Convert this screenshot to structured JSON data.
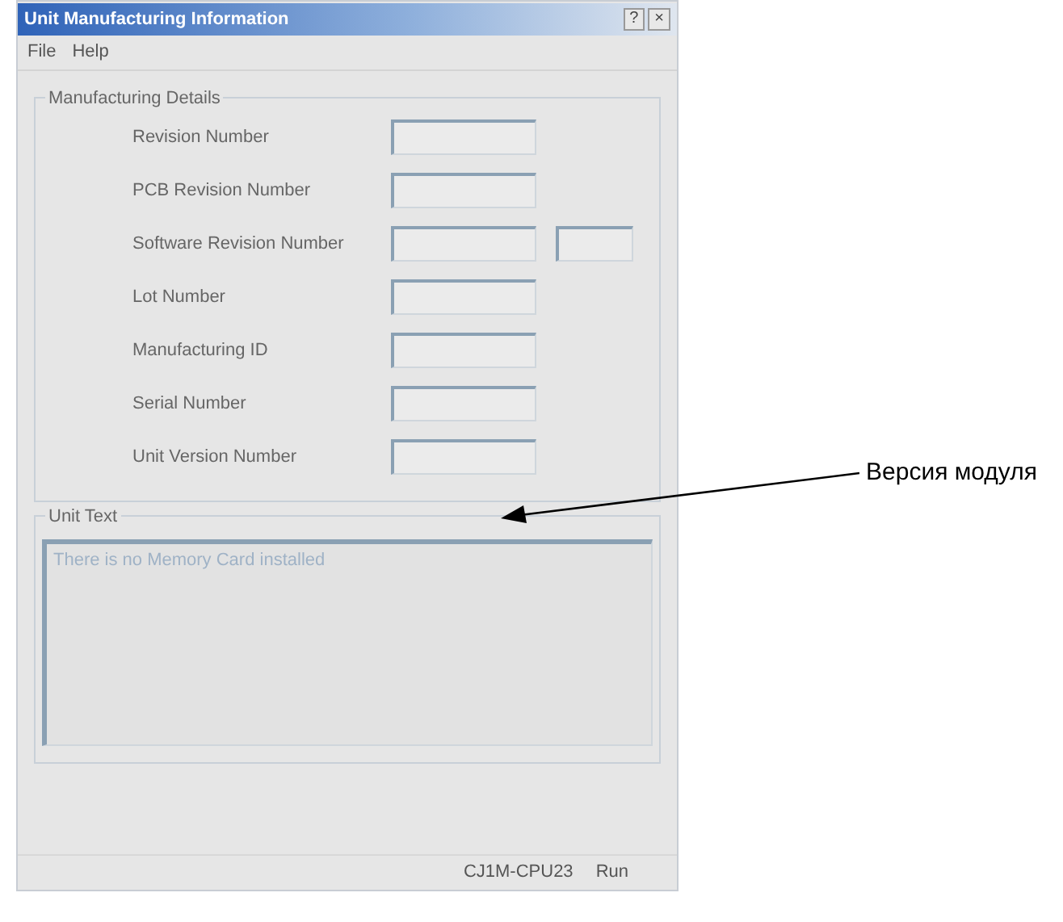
{
  "window": {
    "title": "Unit Manufacturing Information",
    "title_buttons": [
      "?",
      "×"
    ]
  },
  "menu": [
    "File",
    "Help"
  ],
  "details_group": {
    "title": "Manufacturing Details",
    "rows": [
      {
        "label": "Revision Number",
        "kind": "single"
      },
      {
        "label": "PCB Revision Number",
        "kind": "single"
      },
      {
        "label": "Software Revision Number",
        "kind": "double"
      },
      {
        "label": "Lot Number",
        "kind": "single"
      },
      {
        "label": "Manufacturing ID",
        "kind": "single"
      },
      {
        "label": "Serial Number",
        "kind": "single"
      },
      {
        "label": "Unit Version Number",
        "kind": "single"
      }
    ]
  },
  "unit_text_group": {
    "title": "Unit Text",
    "text": "There is no Memory Card installed"
  },
  "status_bar": [
    "CJ1M-CPU23",
    "Run"
  ],
  "annotation": {
    "text": "Версия модуля"
  }
}
